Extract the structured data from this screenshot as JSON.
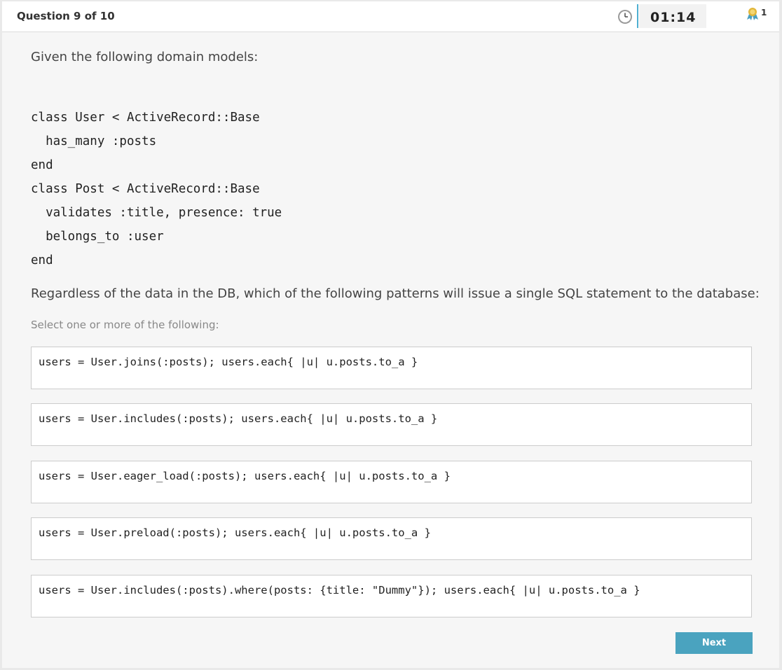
{
  "header": {
    "question_counter": "Question 9 of 10",
    "timer": "01:14",
    "clock_icon": "clock-icon",
    "badge_icon": "award-ribbon-icon",
    "badge_count": "1",
    "accent_color": "#4fb0d1"
  },
  "body": {
    "prompt": "Given the following domain models:",
    "code_lines": [
      "class User < ActiveRecord::Base",
      "  has_many :posts",
      "end",
      "class Post < ActiveRecord::Base",
      "  validates :title, presence: true",
      "  belongs_to :user",
      "end"
    ],
    "question": "Regardless of the data in the DB, which of the following patterns will issue a single SQL statement to the database:",
    "instruction": "Select one or more of the following:",
    "options": [
      "users = User.joins(:posts); users.each{ |u| u.posts.to_a }",
      "users = User.includes(:posts); users.each{ |u| u.posts.to_a }",
      "users = User.eager_load(:posts); users.each{ |u| u.posts.to_a }",
      "users = User.preload(:posts); users.each{ |u| u.posts.to_a }",
      "users = User.includes(:posts).where(posts: {title: \"Dummy\"}); users.each{ |u| u.posts.to_a }"
    ]
  },
  "footer": {
    "next_label": "Next",
    "button_color": "#4aa3bf"
  }
}
